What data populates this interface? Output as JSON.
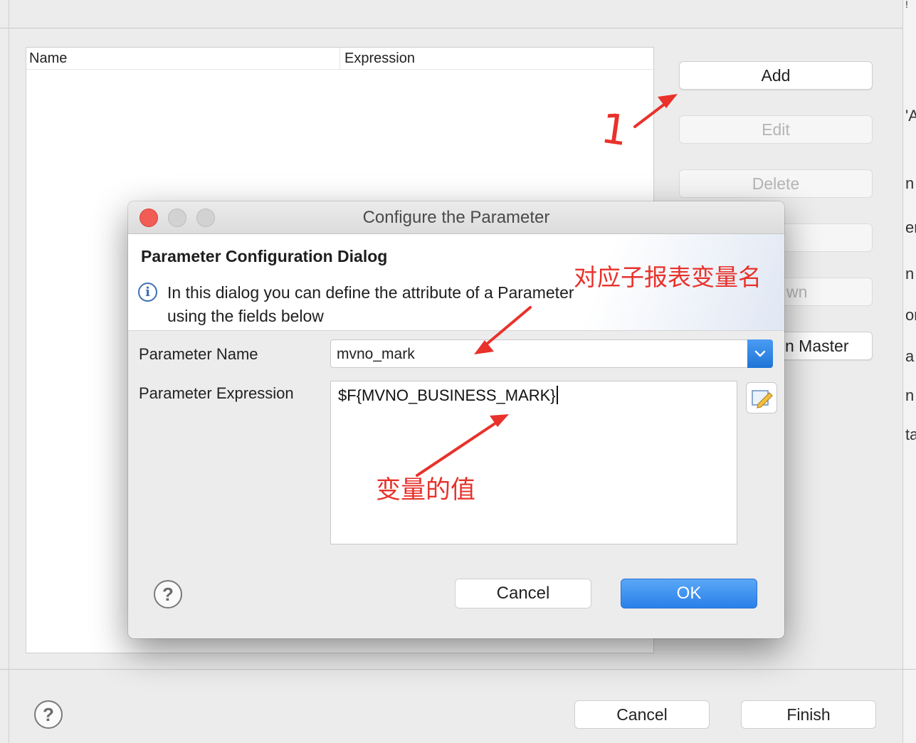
{
  "background_window": {
    "table": {
      "columns": [
        "Name",
        "Expression"
      ]
    },
    "side_buttons": {
      "add": "Add",
      "edit": "Edit",
      "delete": "Delete",
      "partial_down": "wn",
      "partial_master": "n Master"
    },
    "right_fragments": [
      "!",
      "'A",
      "n",
      "er",
      "n",
      "or",
      "a",
      "n",
      "ta"
    ],
    "footer": {
      "cancel": "Cancel",
      "finish": "Finish",
      "help": "?"
    }
  },
  "dialog": {
    "title": "Configure the Parameter",
    "banner_title": "Parameter Configuration Dialog",
    "info_icon": "i",
    "banner_desc": "In this dialog you can define the attribute of a Parameter using the fields below",
    "name_label": "Parameter Name",
    "name_value": "mvno_mark",
    "expr_label": "Parameter Expression",
    "expr_value": "$F{MVNO_BUSINESS_MARK}",
    "help": "?",
    "cancel": "Cancel",
    "ok": "OK",
    "icons": [
      "close-light-red",
      "minimize-light-gray",
      "zoom-light-gray",
      "info-icon",
      "chevron-down-icon",
      "expression-editor-icon",
      "help-icon"
    ]
  },
  "annotations": {
    "step_number": "1",
    "name_note": "对应子报表变量名",
    "value_note": "变量的值",
    "color": "#e8322b"
  }
}
